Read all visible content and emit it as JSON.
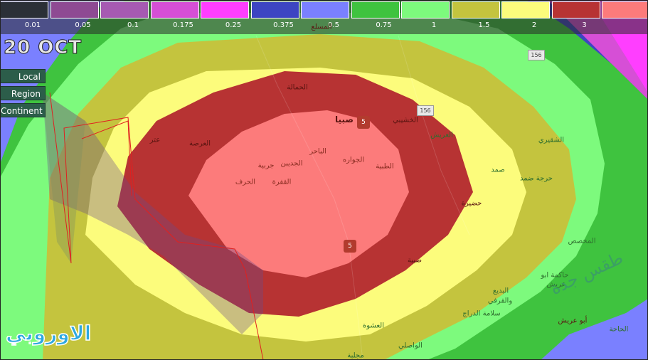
{
  "legend": {
    "colors": [
      "#2b3037",
      "#8e4a93",
      "#a65ab2",
      "#d64fd6",
      "#ff3eff",
      "#3d45c2",
      "#7a80ff",
      "#3fc33f",
      "#7dfa7d",
      "#c4c43e",
      "#fcfc7c",
      "#b73333",
      "#fc7b7b"
    ],
    "ticks": [
      "0.01",
      "0.05",
      "0.1",
      "0.175",
      "0.25",
      "0.375",
      "0.5",
      "0.75",
      "1",
      "1.5",
      "2",
      "3"
    ]
  },
  "date_label": "20 OCT",
  "scope_buttons": [
    "Local",
    "Region",
    "Continent"
  ],
  "places": [
    {
      "name": "الحمالة",
      "cls": "dark"
    },
    {
      "name": "صبيا",
      "cls": "city"
    },
    {
      "name": "الخشيبي",
      "cls": "dark"
    },
    {
      "name": "العريش",
      "cls": "light"
    },
    {
      "name": "عتر",
      "cls": "dark"
    },
    {
      "name": "العرصة",
      "cls": "dark"
    },
    {
      "name": "الباحر",
      "cls": "mid"
    },
    {
      "name": "الجواره",
      "cls": "mid"
    },
    {
      "name": "الطبية",
      "cls": "mid"
    },
    {
      "name": "الجديبن",
      "cls": "mid"
    },
    {
      "name": "جربية",
      "cls": "mid"
    },
    {
      "name": "الحرف",
      "cls": "mid"
    },
    {
      "name": "القفرة",
      "cls": "mid"
    },
    {
      "name": "الشقيري",
      "cls": "light"
    },
    {
      "name": "صمد",
      "cls": "light"
    },
    {
      "name": "حرجة ضمد",
      "cls": "light"
    },
    {
      "name": "حضيرة",
      "cls": "dark"
    },
    {
      "name": "صبية",
      "cls": "dark"
    },
    {
      "name": "المخصص",
      "cls": "light"
    },
    {
      "name": "حاكمة ابو",
      "cls": "light"
    },
    {
      "name": "عريش",
      "cls": "light"
    },
    {
      "name": "البديع",
      "cls": "light"
    },
    {
      "name": "والقرفي",
      "cls": "light"
    },
    {
      "name": "سلامة الدراج",
      "cls": "light"
    },
    {
      "name": "أبو عريش",
      "cls": "dark"
    },
    {
      "name": "العشوة",
      "cls": "light"
    },
    {
      "name": "الواصلي",
      "cls": "light"
    },
    {
      "name": "مجلبة",
      "cls": "light"
    },
    {
      "name": "الحاحة",
      "cls": "light"
    },
    {
      "name": "المسلع",
      "cls": "dark"
    }
  ],
  "road_numbers": [
    "156",
    "156"
  ],
  "route_numbers": [
    "5",
    "5"
  ],
  "watermark": "الاوروبي",
  "watermark_right": "طقس جدة"
}
